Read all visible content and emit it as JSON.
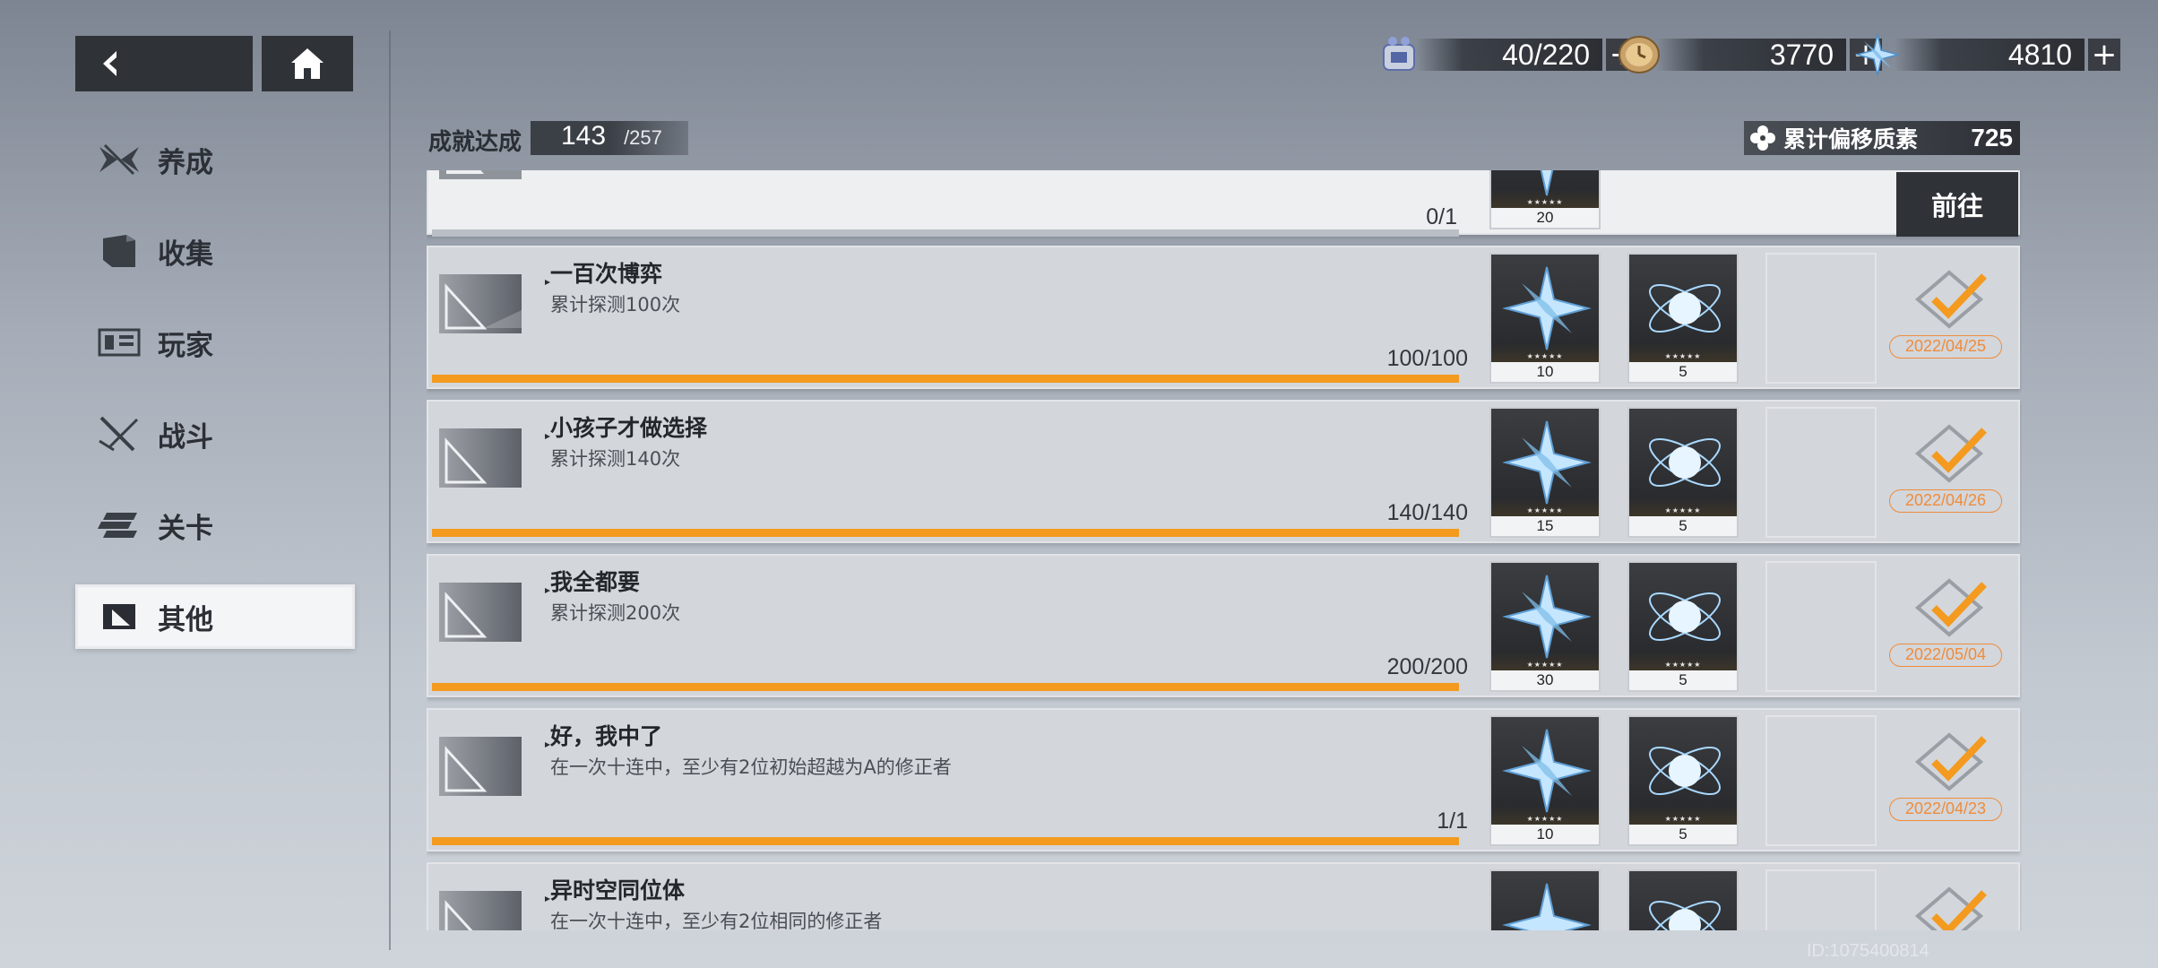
{
  "nav": {
    "back_icon": "arrow-left-icon",
    "home_icon": "home-icon"
  },
  "resources": [
    {
      "icon": "stamina-device-icon",
      "value": "40/220",
      "plus": "+"
    },
    {
      "icon": "coin-clock-icon",
      "value": "3770",
      "plus": "+"
    },
    {
      "icon": "crystal-star-icon",
      "value": "4810",
      "plus": "+"
    }
  ],
  "sidebar": {
    "items": [
      {
        "label": "养成",
        "icon": "wings-icon"
      },
      {
        "label": "收集",
        "icon": "book-icon"
      },
      {
        "label": "玩家",
        "icon": "id-card-icon"
      },
      {
        "label": "战斗",
        "icon": "crossed-swords-icon"
      },
      {
        "label": "关卡",
        "icon": "stack-icon"
      },
      {
        "label": "其他",
        "icon": "triangle-square-icon"
      }
    ],
    "active_index": 5
  },
  "header": {
    "achievement_label": "成就达成",
    "achieved": "143",
    "total": "/257",
    "offset_label": "累计偏移质素",
    "offset_value": "725"
  },
  "achievements": [
    {
      "title": "",
      "desc": "",
      "progress": "0/1",
      "progress_fraction": 0,
      "rewards": [
        {
          "icon": "crystal-star-icon",
          "qty": "20"
        }
      ],
      "status": "goto",
      "goto_label": "前往"
    },
    {
      "title": "一百次博弈",
      "desc": "累计探测100次",
      "progress": "100/100",
      "progress_fraction": 1,
      "rewards": [
        {
          "icon": "crystal-star-icon",
          "qty": "10"
        },
        {
          "icon": "atom-orb-icon",
          "qty": "5"
        }
      ],
      "status": "done",
      "date": "2022/04/25"
    },
    {
      "title": "小孩子才做选择",
      "desc": "累计探测140次",
      "progress": "140/140",
      "progress_fraction": 1,
      "rewards": [
        {
          "icon": "crystal-star-icon",
          "qty": "15"
        },
        {
          "icon": "atom-orb-icon",
          "qty": "5"
        }
      ],
      "status": "done",
      "date": "2022/04/26"
    },
    {
      "title": "我全都要",
      "desc": "累计探测200次",
      "progress": "200/200",
      "progress_fraction": 1,
      "rewards": [
        {
          "icon": "crystal-star-icon",
          "qty": "30"
        },
        {
          "icon": "atom-orb-icon",
          "qty": "5"
        }
      ],
      "status": "done",
      "date": "2022/05/04"
    },
    {
      "title": "好，我中了",
      "desc": "在一次十连中，至少有2位初始超越为A的修正者",
      "progress": "1/1",
      "progress_fraction": 1,
      "rewards": [
        {
          "icon": "crystal-star-icon",
          "qty": "10"
        },
        {
          "icon": "atom-orb-icon",
          "qty": "5"
        }
      ],
      "status": "done",
      "date": "2022/04/23"
    },
    {
      "title": "异时空同位体",
      "desc": "在一次十连中，至少有2位相同的修正者",
      "progress": "",
      "progress_fraction": 1,
      "rewards": [
        {
          "icon": "crystal-star-icon",
          "qty": ""
        },
        {
          "icon": "atom-orb-icon",
          "qty": ""
        }
      ],
      "status": "done",
      "date": ""
    }
  ],
  "uid": "ID:1075400814",
  "colors": {
    "accent": "#f39a1f",
    "dark_panel": "#2f3237",
    "date_badge": "#ef8c3a"
  }
}
